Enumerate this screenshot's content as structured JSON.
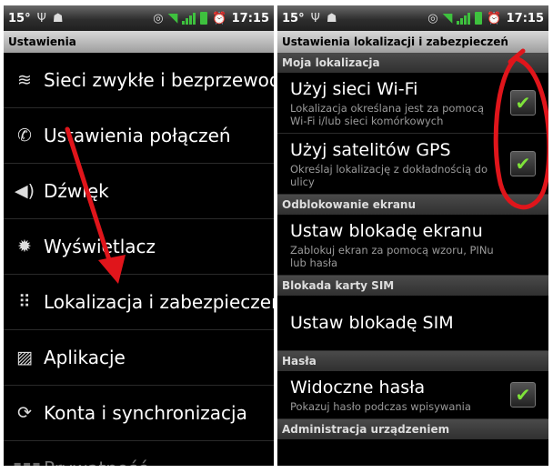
{
  "left": {
    "status": {
      "temp": "15°",
      "time": "17:15"
    },
    "title": "Ustawienia",
    "items": [
      {
        "label": "Sieci zwykłe i bezprzewodowe",
        "icon": "wifi-icon",
        "glyph": "≋"
      },
      {
        "label": "Ustawienia połączeń",
        "icon": "phone-icon",
        "glyph": "✆"
      },
      {
        "label": "Dźwięk",
        "icon": "speaker-icon",
        "glyph": "◀)"
      },
      {
        "label": "Wyświetlacz",
        "icon": "brightness-icon",
        "glyph": "✹"
      },
      {
        "label": "Lokalizacja i zabezpieczenia",
        "icon": "location-grid-icon",
        "glyph": "⠿"
      },
      {
        "label": "Aplikacje",
        "icon": "applications-icon",
        "glyph": "▨"
      },
      {
        "label": "Konta i synchronizacja",
        "icon": "sync-icon",
        "glyph": "⟳"
      },
      {
        "label": "Prywatność",
        "icon": "privacy-icon",
        "glyph": "▮▮▮"
      }
    ]
  },
  "right": {
    "status": {
      "temp": "15°",
      "time": "17:15"
    },
    "title": "Ustawienia lokalizacji i zabezpieczeń",
    "sections": [
      {
        "header": "Moja lokalizacja",
        "prefs": [
          {
            "title": "Użyj sieci Wi-Fi",
            "summary": "Lokalizacja określana jest za pomocą Wi-Fi i/lub sieci komórkowych",
            "checked": true
          },
          {
            "title": "Użyj satelitów GPS",
            "summary": "Określaj lokalizację z dokładnością do ulicy",
            "checked": true
          }
        ]
      },
      {
        "header": "Odblokowanie ekranu",
        "prefs": [
          {
            "title": "Ustaw blokadę ekranu",
            "summary": "Zablokuj ekran za pomocą wzoru, PINu lub hasła",
            "checked": null
          }
        ]
      },
      {
        "header": "Blokada karty SIM",
        "prefs": [
          {
            "title": "Ustaw blokadę SIM",
            "summary": "",
            "checked": null
          }
        ]
      },
      {
        "header": "Hasła",
        "prefs": [
          {
            "title": "Widoczne hasła",
            "summary": "Pokazuj hasło podczas wpisywania",
            "checked": true
          }
        ]
      },
      {
        "header": "Administracja urządzeniem",
        "prefs": []
      }
    ],
    "check_glyph": "✔"
  },
  "colors": {
    "annotation": "#e0151b",
    "check": "#7ee23a",
    "signal": "#3ec13e"
  }
}
